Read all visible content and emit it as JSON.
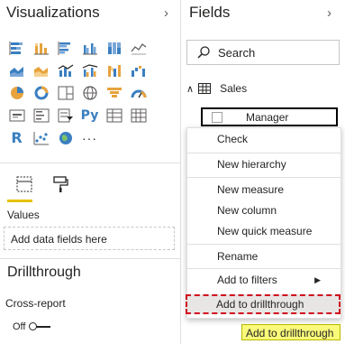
{
  "visualizations": {
    "title": "Visualizations",
    "collapse_glyph": "›",
    "icon_rows": [
      [
        "stacked-bar-chart-icon",
        "stacked-column-chart-icon",
        "clustered-bar-chart-icon",
        "clustered-column-chart-icon",
        "100-stacked-bar-chart-icon",
        "line-chart-icon"
      ],
      [
        "area-chart-icon",
        "stacked-area-chart-icon",
        "line-and-column-chart-icon",
        "line-and-clustered-column-icon",
        "ribbon-chart-icon",
        "waterfall-chart-icon"
      ],
      [
        "pie-chart-icon",
        "donut-chart-icon",
        "treemap-icon",
        "map-icon",
        "funnel-chart-icon",
        "gauge-icon"
      ],
      [
        "card-icon",
        "multi-row-card-icon",
        "slicer-icon",
        "python-visual-icon",
        "table-icon",
        "matrix-icon"
      ],
      [
        "r-visual-icon",
        "scatter-chart-icon",
        "globe-icon",
        "more-visuals-icon"
      ]
    ],
    "values_label": "Values",
    "values_placeholder": "Add data fields here",
    "drillthrough_title": "Drillthrough",
    "cross_report_label": "Cross-report",
    "toggle_label": "Off",
    "accent": "#e8c100"
  },
  "fields": {
    "title": "Fields",
    "collapse_glyph": "›",
    "search_placeholder": "Search",
    "table_name": "Sales",
    "expand_glyph": "∧",
    "field_name": "Manager"
  },
  "context_menu": {
    "items": [
      "Check",
      "New hierarchy",
      "New measure",
      "New column",
      "New quick measure",
      "Rename",
      "Add to filters",
      "Add to drillthrough"
    ],
    "submenu_glyph": "▶",
    "highlight_color": "#d0021b"
  },
  "tooltip": {
    "text": "Add to drillthrough",
    "background": "#fafa7a"
  }
}
